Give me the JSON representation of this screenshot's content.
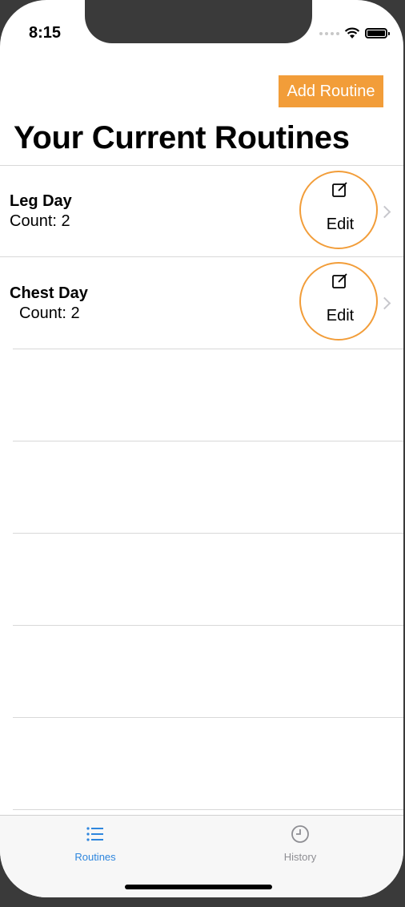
{
  "status_bar": {
    "time": "8:15"
  },
  "header": {
    "add_button_label": "Add Routine",
    "title": "Your Current Routines"
  },
  "routines": [
    {
      "name": "Leg Day",
      "count": "Count: 2",
      "edit_label": "Edit"
    },
    {
      "name": "Chest Day",
      "count": "Count: 2",
      "edit_label": "Edit"
    }
  ],
  "tab_bar": {
    "tabs": [
      {
        "label": "Routines",
        "icon": "list-icon",
        "selected": true
      },
      {
        "label": "History",
        "icon": "clock-icon",
        "selected": false
      }
    ]
  },
  "colors": {
    "accent": "#f29d39",
    "tab_selected": "#2e86de",
    "tab_unselected": "#8e8e93"
  }
}
